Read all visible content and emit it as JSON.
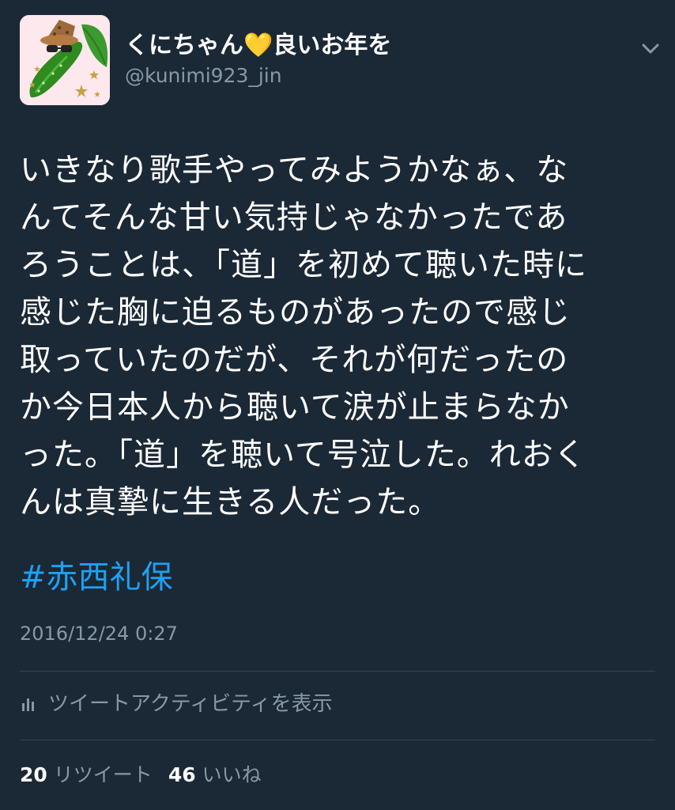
{
  "user": {
    "display_name_start": "くにちゃん",
    "display_name_emoji": "💛",
    "display_name_end": "良いお年を",
    "handle": "@kunimi923_jin",
    "avatar_icon": "cucumber-avatar"
  },
  "menu_icon": "chevron-down-icon",
  "tweet": {
    "lines": [
      "いきなり歌手やってみようかなぁ、な",
      "んてそんな甘い気持じゃなかったであ",
      "ろうことは、「道」を初めて聴いた時に",
      "感じた胸に迫るものがあったので感じ",
      "取っていたのだが、それが何だったの",
      "か今日本人から聴いて涙が止まらなか",
      "った。「道」を聴いて号泣した。れおく",
      "んは真摯に生きる人だった。"
    ],
    "hashtag": "#赤西礼保",
    "timestamp": "2016/12/24 0:27"
  },
  "activity": {
    "icon": "bar-chart-icon",
    "label": "ツイートアクティビティを表示"
  },
  "stats": {
    "retweet_count": "20",
    "retweet_label": "リツイート",
    "like_count": "46",
    "like_label": "いいね"
  },
  "colors": {
    "background": "#1b2836",
    "text_primary": "#ffffff",
    "text_secondary": "#8899a6",
    "link": "#1da1f2",
    "divider": "#38444d"
  }
}
